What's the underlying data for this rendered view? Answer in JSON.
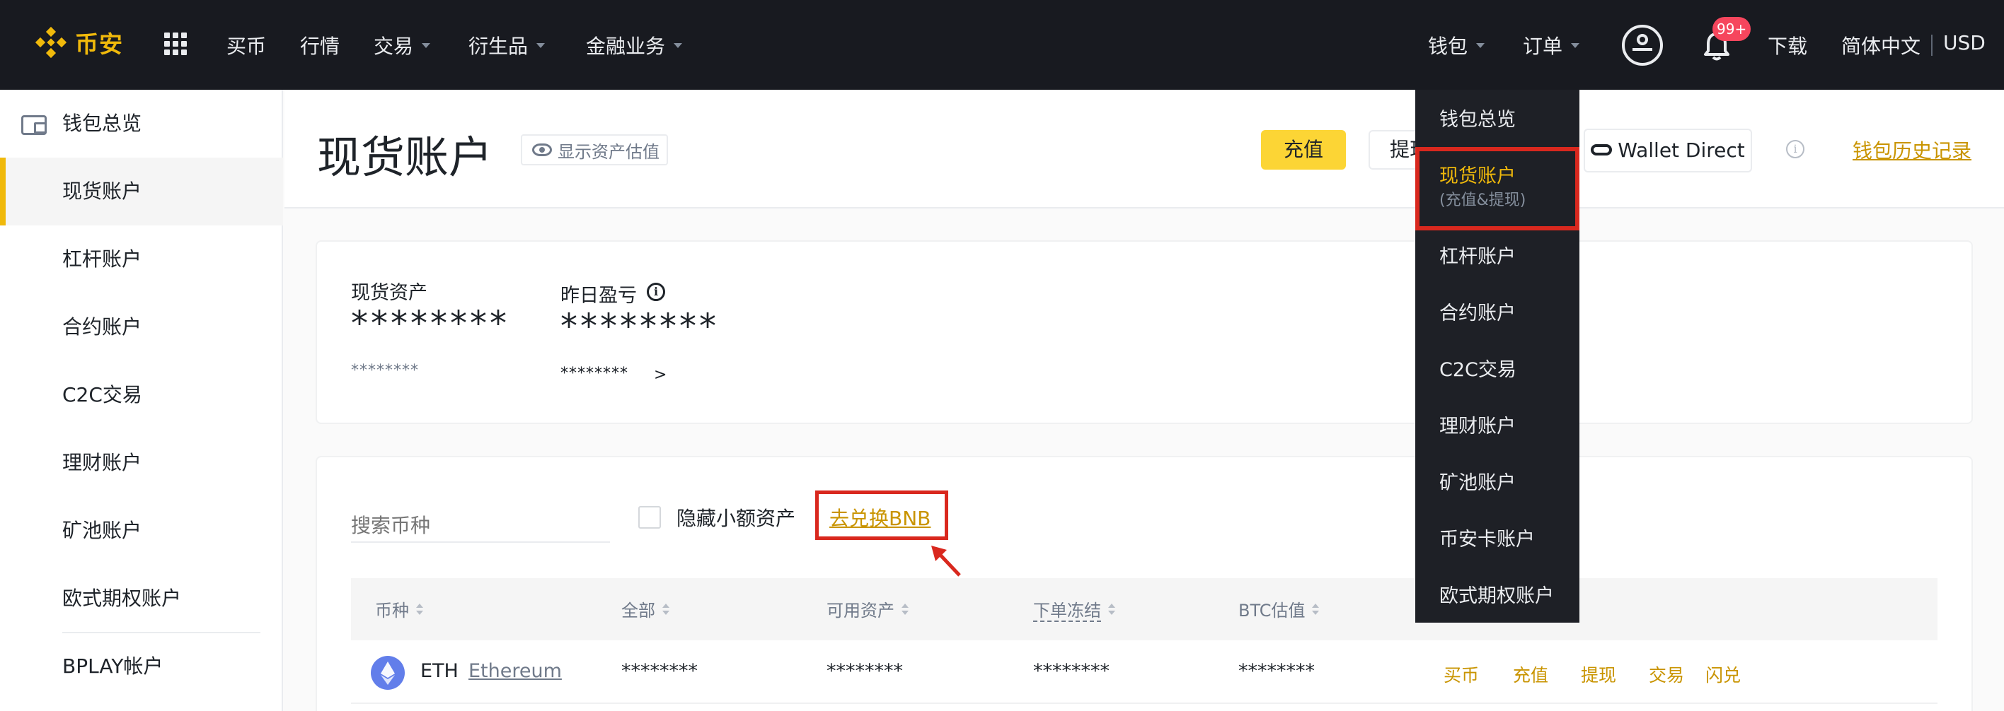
{
  "brand": {
    "name": "币安",
    "color": "#f0b90b"
  },
  "topnav": {
    "items": [
      {
        "label": "买币"
      },
      {
        "label": "行情"
      },
      {
        "label": "交易"
      },
      {
        "label": "衍生品"
      },
      {
        "label": "金融业务"
      }
    ],
    "right": {
      "wallet": "钱包",
      "orders": "订单",
      "badge": "99+",
      "download": "下载",
      "language": "简体中文",
      "currency": "USD"
    }
  },
  "sidebar": {
    "items": [
      {
        "label": "钱包总览"
      },
      {
        "label": "现货账户"
      },
      {
        "label": "杠杆账户"
      },
      {
        "label": "合约账户"
      },
      {
        "label": "C2C交易"
      },
      {
        "label": "理财账户"
      },
      {
        "label": "矿池账户"
      },
      {
        "label": "欧式期权账户"
      },
      {
        "label": "BPLAY帐户"
      }
    ],
    "active_index": 1
  },
  "header": {
    "title": "现货账户",
    "show_estimate": "显示资产估值",
    "deposit": "充值",
    "withdraw": "提现",
    "wallet_direct": "Wallet Direct",
    "history": "钱包历史记录"
  },
  "balance": {
    "spot_label": "现货资产",
    "spot_value": "********",
    "spot_sub": "********",
    "pnl_label": "昨日盈亏",
    "pnl_value": "********",
    "pnl_sub": "********",
    "pnl_arrow": ">"
  },
  "assets": {
    "search_placeholder": "搜索币种",
    "hide_small": "隐藏小额资产",
    "convert_bnb": "去兑换BNB",
    "columns": [
      "币种",
      "全部",
      "可用资产",
      "下单冻结",
      "BTC估值"
    ],
    "rows": [
      {
        "symbol": "ETH",
        "name": "Ethereum",
        "total": "********",
        "available": "********",
        "frozen": "********",
        "btc": "********",
        "actions": [
          "买币",
          "充值",
          "提现",
          "交易",
          "闪兑"
        ]
      }
    ]
  },
  "wallet_dropdown": {
    "items": [
      {
        "label": "钱包总览"
      },
      {
        "label": "现货账户",
        "sub": "(充值&提现)"
      },
      {
        "label": "杠杆账户"
      },
      {
        "label": "合约账户"
      },
      {
        "label": "C2C交易"
      },
      {
        "label": "理财账户"
      },
      {
        "label": "矿池账户"
      },
      {
        "label": "币安卡账户"
      },
      {
        "label": "欧式期权账户"
      }
    ]
  },
  "colors": {
    "accent": "#f0b90b",
    "highlight": "#d9281e",
    "link": "#c99400"
  }
}
